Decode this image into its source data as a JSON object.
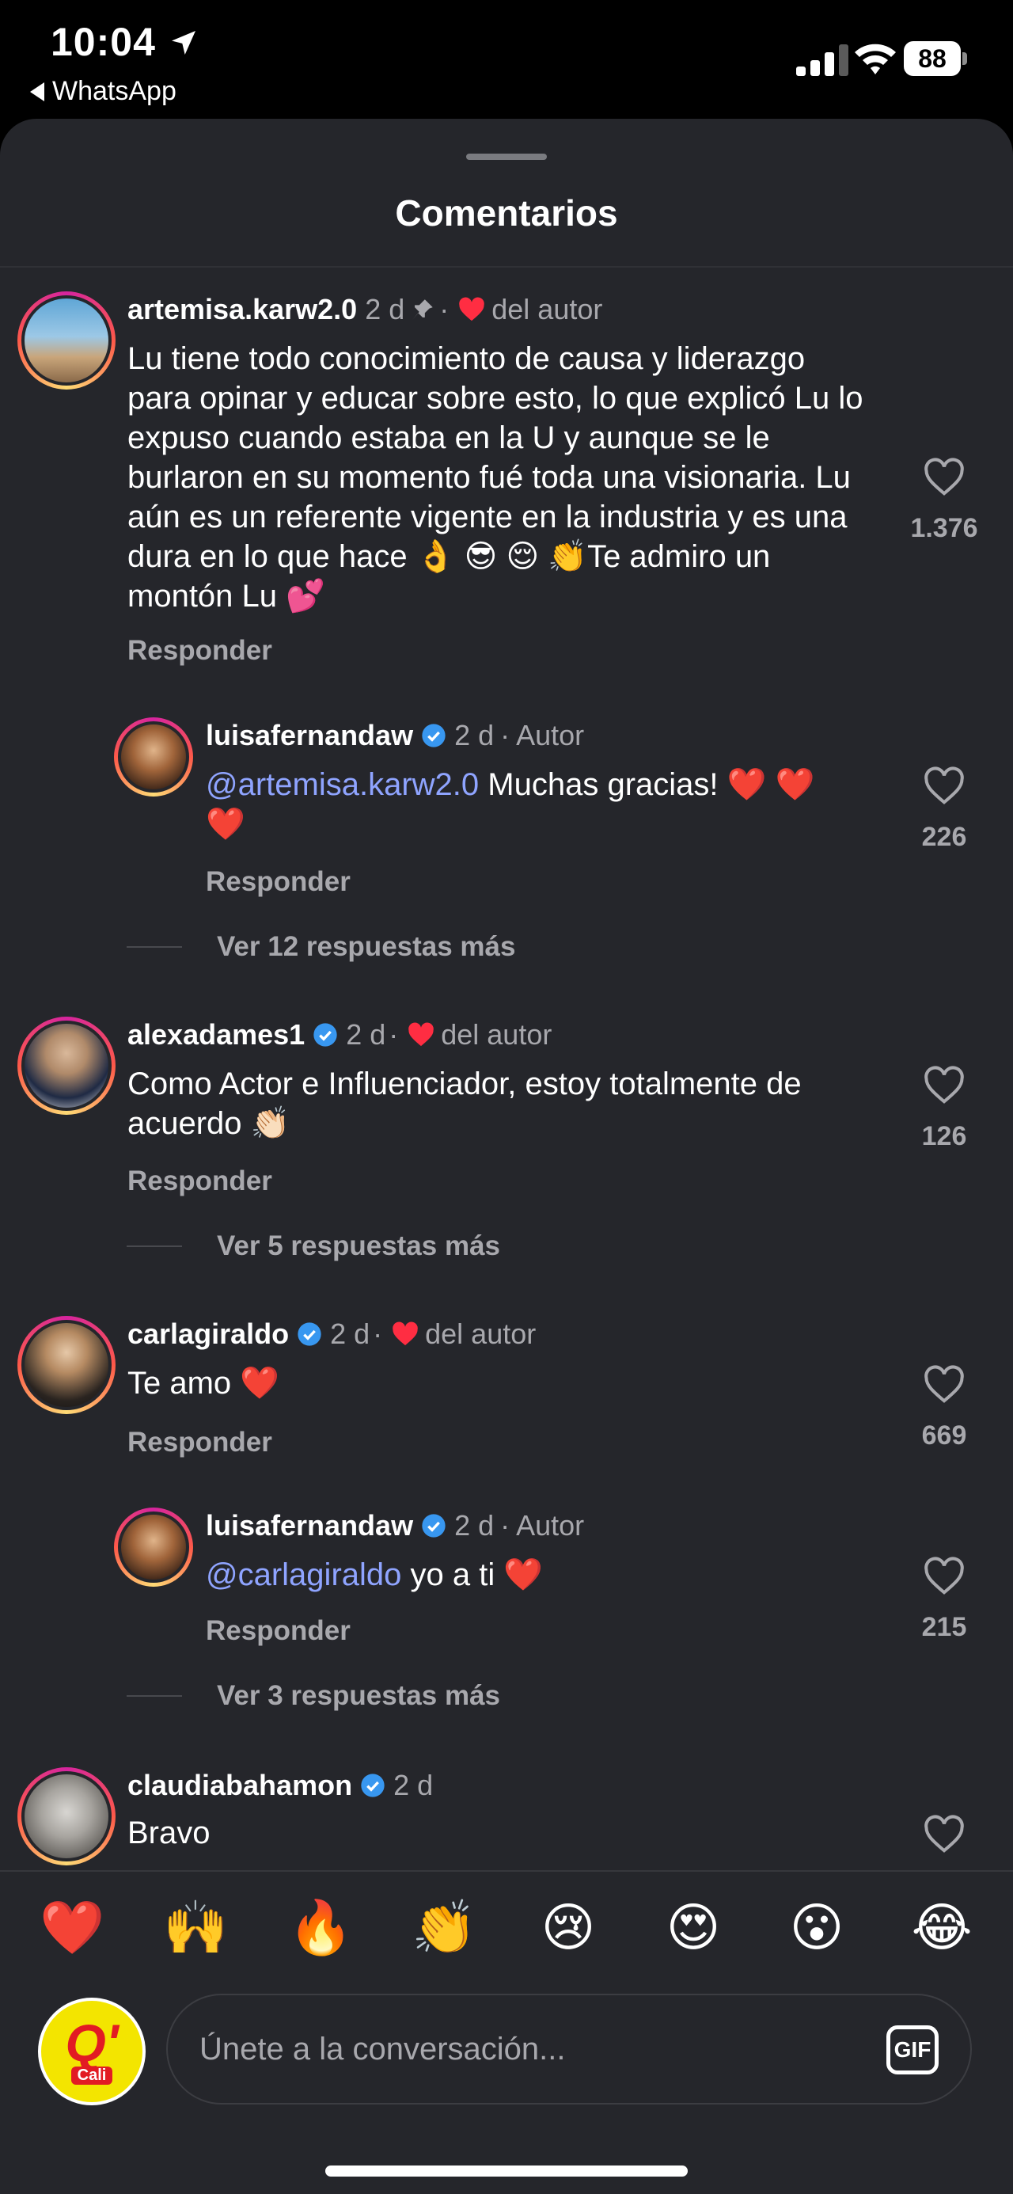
{
  "status_bar": {
    "time": "10:04",
    "back_label": "WhatsApp",
    "battery": "88"
  },
  "sheet": {
    "title": "Comentarios"
  },
  "comments": [
    {
      "username": "artemisa.karw2.0",
      "age": "2 d",
      "author_like": "del autor",
      "text": "Lu tiene todo conocimiento de causa y liderazgo para opinar y educar sobre esto, lo que explicó Lu lo expuso cuando estaba en la U y aunque se le burlaron en su momento fué toda una visionaria. Lu aún es un referente vigente en la industria y es una dura en lo que hace 👌 😎 😌 👏Te admiro un montón Lu 💕",
      "likes": "1.376",
      "reply": "Responder"
    },
    {
      "username": "luisafernandaw",
      "age": "2 d",
      "tag": "Autor",
      "mention": "@artemisa.karw2.0",
      "text": " Muchas gracias! ❤️ ❤️ ❤️",
      "likes": "226",
      "reply": "Responder",
      "more": "Ver 12 respuestas más"
    },
    {
      "username": "alexadames1",
      "age": "2 d",
      "author_like": "del autor",
      "text": "Como Actor e Influenciador, estoy totalmente de acuerdo 👏🏻",
      "likes": "126",
      "reply": "Responder",
      "more": "Ver 5 respuestas más"
    },
    {
      "username": "carlagiraldo",
      "age": "2 d",
      "author_like": "del autor",
      "text": "Te amo ❤️",
      "likes": "669",
      "reply": "Responder"
    },
    {
      "username": "luisafernandaw",
      "age": "2 d",
      "tag": "Autor",
      "mention": "@carlagiraldo",
      "text": " yo a ti ❤️",
      "likes": "215",
      "reply": "Responder",
      "more": "Ver 3 respuestas más"
    },
    {
      "username": "claudiabahamon",
      "age": "2 d",
      "text": "Bravo"
    }
  ],
  "emoji_reactions": [
    "❤️",
    "🙌",
    "🔥",
    "👏",
    "😢",
    "😍",
    "😮",
    "😂"
  ],
  "composer": {
    "avatar_text": "Q'",
    "avatar_sub": "Cali",
    "placeholder": "Únete a la conversación...",
    "gif_label": "GIF"
  },
  "colors": {
    "background": "#25262b",
    "mention": "#8fa4ff",
    "heart": "#ff2d42",
    "verified": "#3897f0"
  }
}
